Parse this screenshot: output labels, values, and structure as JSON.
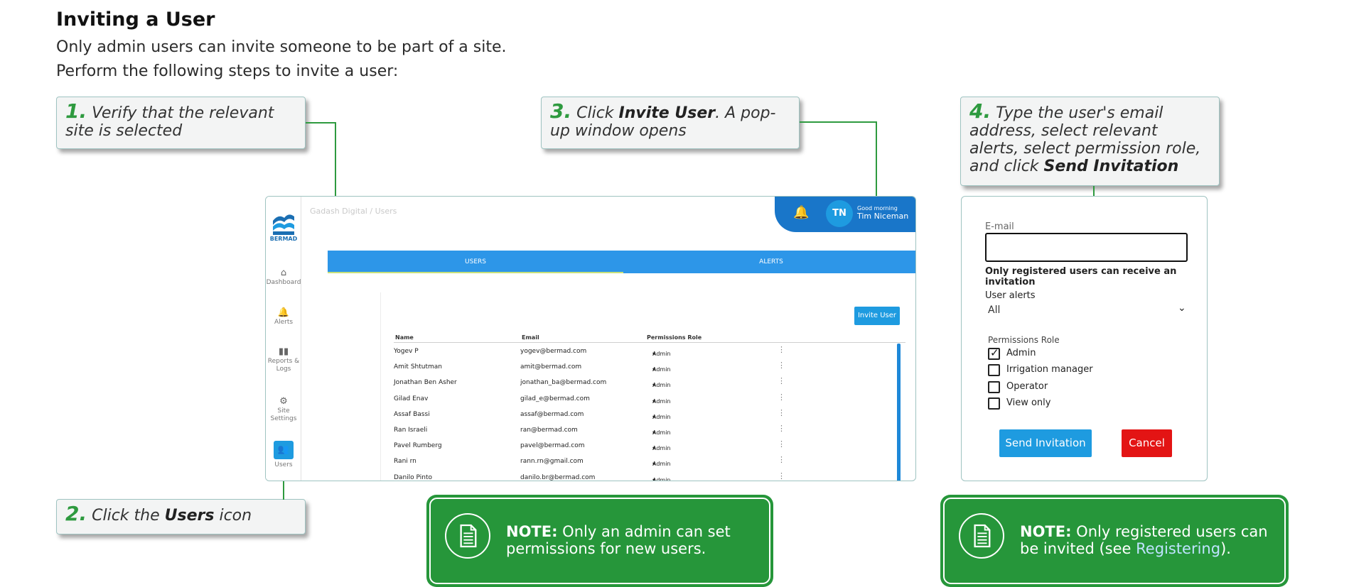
{
  "title": "Inviting a User",
  "intro": [
    "Only admin users can invite someone to be part of a site.",
    "Perform the following steps to invite a user:"
  ],
  "steps": {
    "s1": {
      "num": "1.",
      "text": "Verify that the relevant site is selected"
    },
    "s2": {
      "num": "2.",
      "pre": "Click the ",
      "bold": "Users",
      "post": " icon"
    },
    "s3": {
      "num": "3.",
      "pre": "Click ",
      "bold": "Invite User",
      "post": ". A pop-up window opens"
    },
    "s4": {
      "num": "4.",
      "pre": "Type the user's email address, select relevant alerts, select permission role, and click ",
      "bold": "Send Invitation"
    }
  },
  "app": {
    "logo_text": "BERMAD",
    "breadcrumb": {
      "site": "Gadash Digital",
      "separator": "/",
      "page": "Users"
    },
    "avatar": "TN",
    "greeting": "Good morning",
    "user_name": "Tim Niceman",
    "nav": [
      {
        "label": "Dashboard",
        "icon": "home-icon"
      },
      {
        "label": "Alerts",
        "icon": "bell-icon"
      },
      {
        "label": "Reports & Logs",
        "icon": "bar-chart-icon"
      },
      {
        "label": "Site Settings",
        "icon": "gear-icon"
      },
      {
        "label": "Users",
        "icon": "users-icon"
      }
    ],
    "tabs": [
      "USERS",
      "ALERTS"
    ],
    "invite_button": "Invite User",
    "columns": [
      "Name",
      "Email",
      "Permissions Role"
    ],
    "users": [
      {
        "name": "Yogev P",
        "email": "yogev@bermad.com",
        "role": "Admin"
      },
      {
        "name": "Amit Shtutman",
        "email": "amit@bermad.com",
        "role": "Admin"
      },
      {
        "name": "Jonathan Ben Asher",
        "email": "jonathan_ba@bermad.com",
        "role": "Admin"
      },
      {
        "name": "Gilad Enav",
        "email": "gilad_e@bermad.com",
        "role": "Admin"
      },
      {
        "name": "Assaf Bassi",
        "email": "assaf@bermad.com",
        "role": "Admin"
      },
      {
        "name": "Ran Israeli",
        "email": "ran@bermad.com",
        "role": "Admin"
      },
      {
        "name": "Pavel Rumberg",
        "email": "pavel@bermad.com",
        "role": "Admin"
      },
      {
        "name": "Rani rn",
        "email": "rann.rn@gmail.com",
        "role": "Admin"
      },
      {
        "name": "Danilo Pinto",
        "email": "danilo.br@bermad.com",
        "role": "Admin"
      }
    ]
  },
  "popup": {
    "email_label": "E-mail",
    "email_value": "",
    "helper": "Only registered users can receive an invitation",
    "alerts_label": "User alerts",
    "alerts_value": "All",
    "role_label": "Permissions Role",
    "roles": [
      {
        "label": "Admin",
        "checked": true
      },
      {
        "label": "Irrigation manager",
        "checked": false
      },
      {
        "label": "Operator",
        "checked": false
      },
      {
        "label": "View only",
        "checked": false
      }
    ],
    "send": "Send Invitation",
    "cancel": "Cancel"
  },
  "notes": {
    "n1": {
      "label": "NOTE:",
      "text": " Only an admin can set permissions for new users."
    },
    "n2": {
      "label": "NOTE:",
      "text_before": " Only registered users can be invited (see ",
      "link": "Registering",
      "text_after": ")."
    }
  },
  "colors": {
    "accent_green": "#2e9a3f",
    "note_green": "#26963a",
    "primary_blue": "#1e9be0",
    "cancel_red": "#e31414"
  }
}
